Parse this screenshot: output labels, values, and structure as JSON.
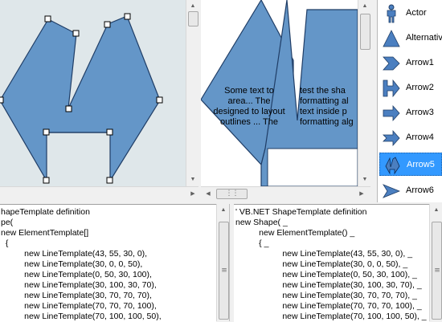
{
  "preview": {
    "text_left": [
      "Some text to",
      "area... The",
      "designed to layout",
      "outlines ... The"
    ],
    "text_right": [
      "test the sha",
      "formatting al",
      "text inside p",
      "formatting alg"
    ]
  },
  "shape_list": {
    "items": [
      {
        "label": "Actor",
        "icon": "actor-icon"
      },
      {
        "label": "Alternative",
        "icon": "triangle-icon"
      },
      {
        "label": "Arrow1",
        "icon": "chevron-arrow-icon"
      },
      {
        "label": "Arrow2",
        "icon": "double-notch-arrow-icon"
      },
      {
        "label": "Arrow3",
        "icon": "block-arrow-icon"
      },
      {
        "label": "Arrow4",
        "icon": "notched-block-arrow-icon"
      },
      {
        "label": "Arrow5",
        "icon": "compound-arrow-icon",
        "selected": true
      },
      {
        "label": "Arrow6",
        "icon": "dart-arrow-icon"
      }
    ]
  },
  "code_left": {
    "lines": [
      "hapeTemplate definition",
      "pe(",
      "new ElementTemplate[]",
      "  {",
      "          new LineTemplate(43, 55, 30, 0),",
      "          new LineTemplate(30, 0, 0, 50),",
      "          new LineTemplate(0, 50, 30, 100),",
      "          new LineTemplate(30, 100, 30, 70),",
      "          new LineTemplate(30, 70, 70, 70),",
      "          new LineTemplate(70, 70, 70, 100),",
      "          new LineTemplate(70, 100, 100, 50),"
    ]
  },
  "code_right": {
    "lines": [
      "' VB.NET ShapeTemplate definition",
      "new Shape( _",
      "          new ElementTemplate() _",
      "          { _",
      "                    new LineTemplate(43, 55, 30, 0), _",
      "                    new LineTemplate(30, 0, 0, 50), _",
      "                    new LineTemplate(0, 50, 30, 100), _",
      "                    new LineTemplate(30, 100, 30, 70), _",
      "                    new LineTemplate(30, 70, 70, 70), _",
      "                    new LineTemplate(70, 70, 70, 100), _",
      "                    new LineTemplate(70, 100, 100, 50), _"
    ]
  },
  "colors": {
    "shape_fill": "#6496c8",
    "shape_stroke": "#1f3d66",
    "editor_bg": "#dfe7ea",
    "selection": "#3399ff"
  }
}
